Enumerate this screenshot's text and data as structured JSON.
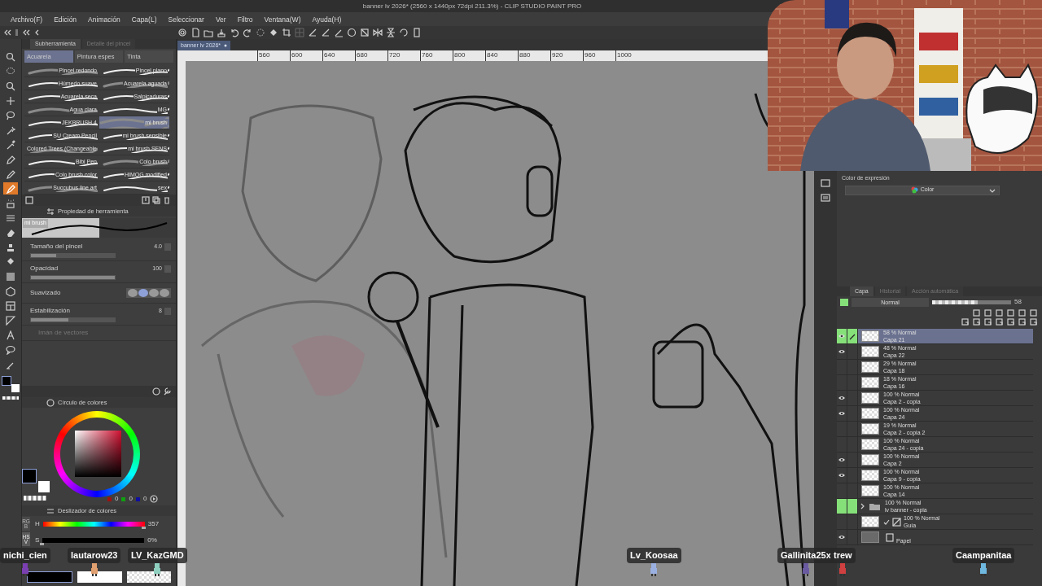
{
  "window": {
    "title": "banner lv 2026* (2560 x 1440px 72dpi 211.3%)  - CLIP STUDIO PAINT PRO"
  },
  "menu": [
    "Archivo(F)",
    "Edición",
    "Animación",
    "Capa(L)",
    "Seleccionar",
    "Ver",
    "Filtro",
    "Ventana(W)",
    "Ayuda(H)"
  ],
  "document_tab": {
    "label": "banner lv 2026*"
  },
  "ruler_marks": [
    "560",
    "600",
    "640",
    "680",
    "720",
    "760",
    "800",
    "840",
    "880",
    "920",
    "960",
    "1000"
  ],
  "tools": [
    {
      "selected": false
    },
    {
      "selected": false
    },
    {
      "selected": false
    },
    {
      "selected": false
    },
    {
      "selected": false
    },
    {
      "selected": false
    },
    {
      "selected": false
    },
    {
      "selected": false
    },
    {
      "selected": false
    },
    {
      "selected": true
    },
    {
      "selected": false
    },
    {
      "selected": false
    },
    {
      "selected": false
    },
    {
      "selected": false
    },
    {
      "selected": false
    },
    {
      "selected": false
    },
    {
      "selected": false
    },
    {
      "selected": false
    },
    {
      "selected": false
    },
    {
      "selected": false
    },
    {
      "selected": false
    },
    {
      "selected": false
    }
  ],
  "subtool_panel": {
    "tabs": [
      {
        "label": "Subherramienta",
        "selected": true
      },
      {
        "label": "Detalle del pincel",
        "selected": false
      }
    ],
    "groups": [
      {
        "label": "Acuarela",
        "selected": true
      },
      {
        "label": "Pintura espes",
        "selected": false
      },
      {
        "label": "Tinta",
        "selected": false
      }
    ],
    "brushes": [
      {
        "label": "Pincel redondo",
        "selected": false
      },
      {
        "label": "Pincel plano",
        "selected": false
      },
      {
        "label": "Húmedo suave",
        "selected": false
      },
      {
        "label": "Acuarela aguada",
        "selected": false
      },
      {
        "label": "Acuarela seca",
        "selected": false
      },
      {
        "label": "Salpicaduras",
        "selected": false
      },
      {
        "label": "Agua clara",
        "selected": false
      },
      {
        "label": "MG",
        "selected": false
      },
      {
        "label": "JEKBRUSH 4",
        "selected": false
      },
      {
        "label": "mi brush",
        "selected": true
      },
      {
        "label": "SU Cream Pencil",
        "selected": false
      },
      {
        "label": "mi brush sensible",
        "selected": false
      },
      {
        "label": "Colored Trees (Changeable",
        "selected": false
      },
      {
        "label": "mi brush SENS",
        "selected": false
      },
      {
        "label": "Bibi Pen",
        "selected": false
      },
      {
        "label": "Colo brush",
        "selected": false
      },
      {
        "label": "Colo brush color",
        "selected": false
      },
      {
        "label": "HIMOG modified",
        "selected": false
      },
      {
        "label": "Succubus line art",
        "selected": false
      },
      {
        "label": "sex",
        "selected": false
      }
    ]
  },
  "tool_property": {
    "title": "Propiedad de herramienta",
    "preview_label": "mi brush",
    "properties": [
      {
        "kind": "slider",
        "label": "Tamaño del pincel",
        "value": "4.0",
        "level": 0.3
      },
      {
        "kind": "slider",
        "label": "Opacidad",
        "value": "100",
        "level": 1
      },
      {
        "kind": "choice",
        "label": "Suavizado",
        "options": [
          {
            "selected": false
          },
          {
            "selected": true
          },
          {
            "selected": false
          },
          {
            "selected": false
          }
        ]
      },
      {
        "kind": "slider",
        "label": "Estabilización",
        "value": "8",
        "level": 0.45
      },
      {
        "kind": "disabled",
        "label": "Imán de vectores"
      }
    ]
  },
  "color_wheel": {
    "title": "Círculo de colores",
    "readouts": [
      "0",
      "0",
      "0"
    ]
  },
  "color_slider": {
    "title": "Deslizador de colores",
    "side_tabs": [
      {
        "label": "RGB",
        "selected": false
      },
      {
        "label": "HSV",
        "selected": true
      }
    ],
    "channels": [
      {
        "name": "H",
        "value": "357",
        "level": 0.99
      },
      {
        "name": "S",
        "value": "0%",
        "level": 0
      }
    ]
  },
  "expression_color": {
    "label": "Color de expresión",
    "value": "Color"
  },
  "layer_panel": {
    "tabs": [
      {
        "label": "Capa",
        "selected": true
      },
      {
        "label": "Historial",
        "selected": false
      },
      {
        "label": "Acción automática",
        "selected": false
      }
    ],
    "blend_mode": "Normal",
    "opacity": "58",
    "level": 0.58,
    "layers": [
      {
        "kind": "layer",
        "mode": "58 % Normal",
        "name": "Capa 21",
        "visible": true,
        "selected": true,
        "highlighted": true
      },
      {
        "kind": "layer",
        "mode": "48 % Normal",
        "name": "Capa 22",
        "visible": true,
        "selected": false,
        "highlighted": false
      },
      {
        "kind": "layer",
        "mode": "29 % Normal",
        "name": "Capa 18",
        "visible": false,
        "selected": false,
        "highlighted": false
      },
      {
        "kind": "layer",
        "mode": "18 % Normal",
        "name": "Capa 16",
        "visible": false,
        "selected": false,
        "highlighted": false
      },
      {
        "kind": "layer",
        "mode": "100 % Normal",
        "name": "Capa 2 - copia",
        "visible": true,
        "selected": false,
        "highlighted": false
      },
      {
        "kind": "layer",
        "mode": "100 % Normal",
        "name": "Capa 24",
        "visible": true,
        "selected": false,
        "highlighted": false
      },
      {
        "kind": "layer",
        "mode": "19 % Normal",
        "name": "Capa 2 - copia 2",
        "visible": false,
        "selected": false,
        "highlighted": false
      },
      {
        "kind": "layer",
        "mode": "100 % Normal",
        "name": "Capa 24 - copia",
        "visible": false,
        "selected": false,
        "highlighted": false
      },
      {
        "kind": "layer",
        "mode": "100 % Normal",
        "name": "Capa 2",
        "visible": true,
        "selected": false,
        "highlighted": false
      },
      {
        "kind": "layer",
        "mode": "100 % Normal",
        "name": "Capa 9 - copia",
        "visible": true,
        "selected": false,
        "highlighted": false
      },
      {
        "kind": "layer",
        "mode": "100 % Normal",
        "name": "Capa 14",
        "visible": false,
        "selected": false,
        "highlighted": false
      },
      {
        "kind": "folder",
        "mode": "100 % Normal",
        "name": "lv banner - copia",
        "visible": false,
        "selected": false,
        "highlighted": true
      },
      {
        "kind": "guide",
        "mode": "100 % Normal",
        "name": "Guía",
        "visible": false,
        "selected": false,
        "highlighted": false
      },
      {
        "kind": "paper",
        "name": "Papel",
        "visible": true,
        "selected": false,
        "highlighted": false
      }
    ]
  },
  "chat_overlay": [
    {
      "name": "nichi_cien",
      "color": "#7a3fb0"
    },
    {
      "name": "lautarow23",
      "color": "#e0a070"
    },
    {
      "name": "LV_KazGMD",
      "color": "#8fd0c0"
    },
    {
      "name": "Lv_Koosaa",
      "color": "#9ab0e0"
    },
    {
      "name": "Gallinita25x",
      "color": "#6a5aa0"
    },
    {
      "name": "trew",
      "color": "#d04040"
    },
    {
      "name": "Caampanitaa",
      "color": "#6fb8e0"
    }
  ]
}
